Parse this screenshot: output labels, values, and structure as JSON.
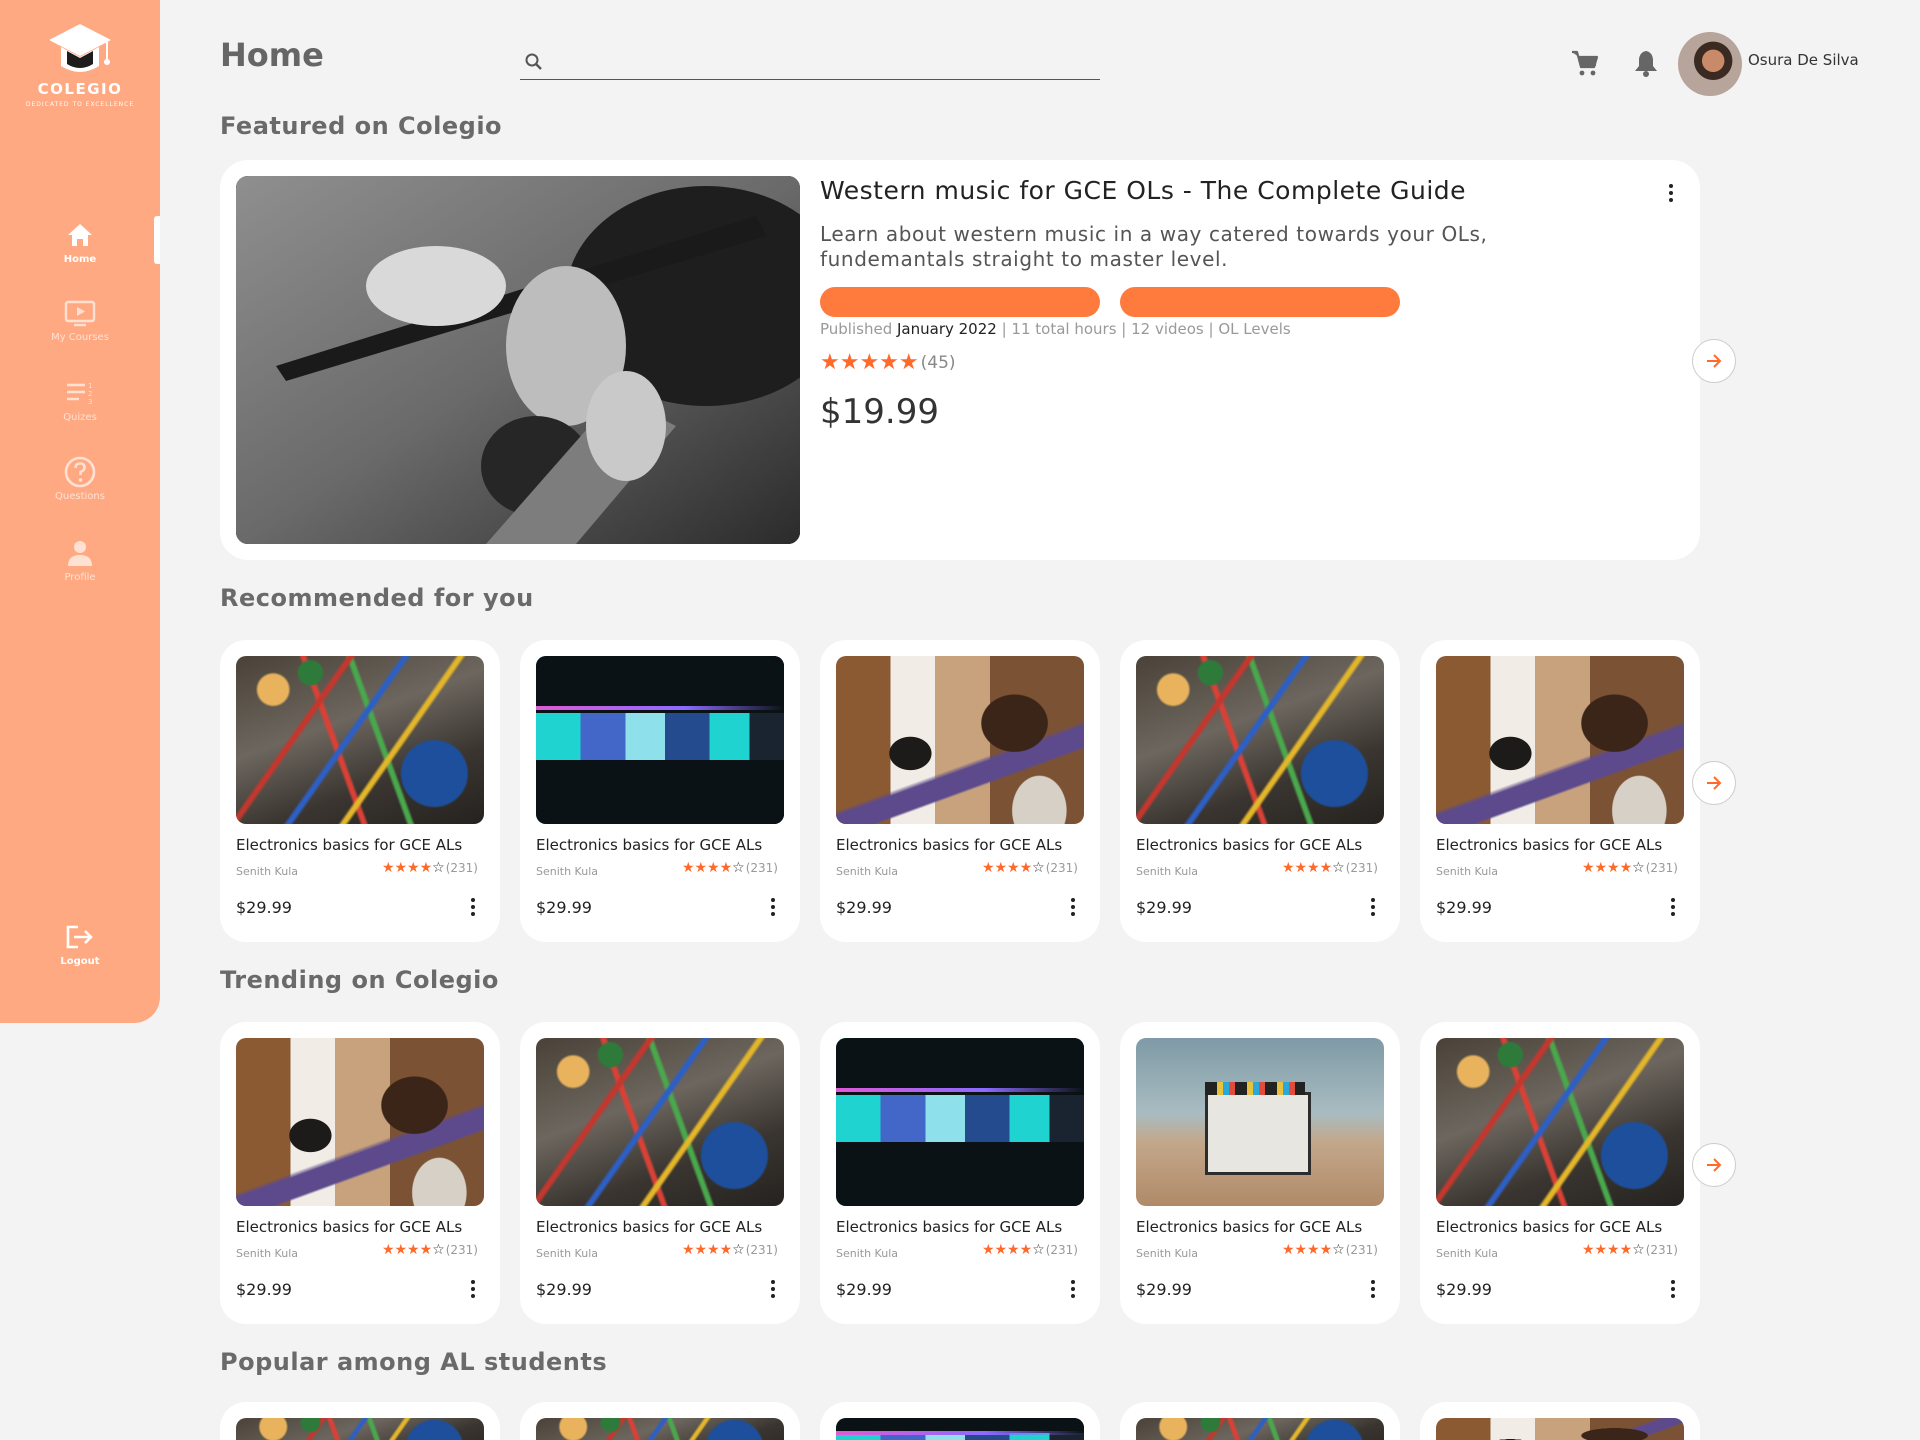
{
  "app": {
    "logo_name": "COLEGIO",
    "logo_tagline": "DEDICATED TO EXCELLENCE"
  },
  "sidebar": {
    "items": [
      {
        "label": "Home",
        "icon": "home-icon",
        "active": true
      },
      {
        "label": "My Courses",
        "icon": "play-screen-icon"
      },
      {
        "label": "Quizes",
        "icon": "list-numbered-icon"
      },
      {
        "label": "Questions",
        "icon": "question-circle-icon"
      },
      {
        "label": "Profile",
        "icon": "person-icon"
      }
    ],
    "logout_label": "Logout"
  },
  "header": {
    "title": "Home",
    "search_placeholder": "",
    "user_name": "Osura De Silva"
  },
  "colors": {
    "sidebar": "#ffa983",
    "accent": "#ff7a3d",
    "star": "#ff6a2b",
    "background": "#f3f3f3"
  },
  "sections": {
    "featured_title": "Featured on Colegio",
    "recommended_title": "Recommended for you",
    "trending_title": "Trending on Colegio",
    "popular_title": "Popular among AL students"
  },
  "featured": {
    "title": "Western music for GCE OLs - The Complete Guide",
    "description": "Learn about western music in a way catered towards your OLs, fundemantals straight to master level.",
    "published_prefix": "Published",
    "published_date": "January 2022",
    "meta_rest": " | 11 total hours | 12 videos | OL Levels",
    "stars": "★★★★★",
    "rating_count": "(45)",
    "price": "$19.99"
  },
  "recommended": [
    {
      "title": "Electronics basics for GCE ALs",
      "author": "Senith Kula",
      "stars": "★★★★",
      "empty_star": "☆",
      "rating_count": "(231)",
      "price": "$29.99",
      "thumb": "electronics"
    },
    {
      "title": "Electronics basics for GCE ALs",
      "author": "Senith Kula",
      "stars": "★★★★",
      "empty_star": "☆",
      "rating_count": "(231)",
      "price": "$29.99",
      "thumb": "video"
    },
    {
      "title": "Electronics basics for GCE ALs",
      "author": "Senith Kula",
      "stars": "★★★★",
      "empty_star": "☆",
      "rating_count": "(231)",
      "price": "$29.99",
      "thumb": "studio"
    },
    {
      "title": "Electronics basics for GCE ALs",
      "author": "Senith Kula",
      "stars": "★★★★",
      "empty_star": "☆",
      "rating_count": "(231)",
      "price": "$29.99",
      "thumb": "electronics"
    },
    {
      "title": "Electronics basics for GCE ALs",
      "author": "Senith Kula",
      "stars": "★★★★",
      "empty_star": "☆",
      "rating_count": "(231)",
      "price": "$29.99",
      "thumb": "studio"
    }
  ],
  "trending": [
    {
      "title": "Electronics basics for GCE ALs",
      "author": "Senith Kula",
      "stars": "★★★★",
      "empty_star": "☆",
      "rating_count": "(231)",
      "price": "$29.99",
      "thumb": "studio"
    },
    {
      "title": "Electronics basics for GCE ALs",
      "author": "Senith Kula",
      "stars": "★★★★",
      "empty_star": "☆",
      "rating_count": "(231)",
      "price": "$29.99",
      "thumb": "electronics"
    },
    {
      "title": "Electronics basics for GCE ALs",
      "author": "Senith Kula",
      "stars": "★★★★",
      "empty_star": "☆",
      "rating_count": "(231)",
      "price": "$29.99",
      "thumb": "video"
    },
    {
      "title": "Electronics basics for GCE ALs",
      "author": "Senith Kula",
      "stars": "★★★★",
      "empty_star": "☆",
      "rating_count": "(231)",
      "price": "$29.99",
      "thumb": "clapper"
    },
    {
      "title": "Electronics basics for GCE ALs",
      "author": "Senith Kula",
      "stars": "★★★★",
      "empty_star": "☆",
      "rating_count": "(231)",
      "price": "$29.99",
      "thumb": "electronics"
    }
  ],
  "popular": [
    {
      "thumb": "electronics"
    },
    {
      "thumb": "electronics"
    },
    {
      "thumb": "video"
    },
    {
      "thumb": "electronics"
    },
    {
      "thumb": "studio"
    }
  ]
}
